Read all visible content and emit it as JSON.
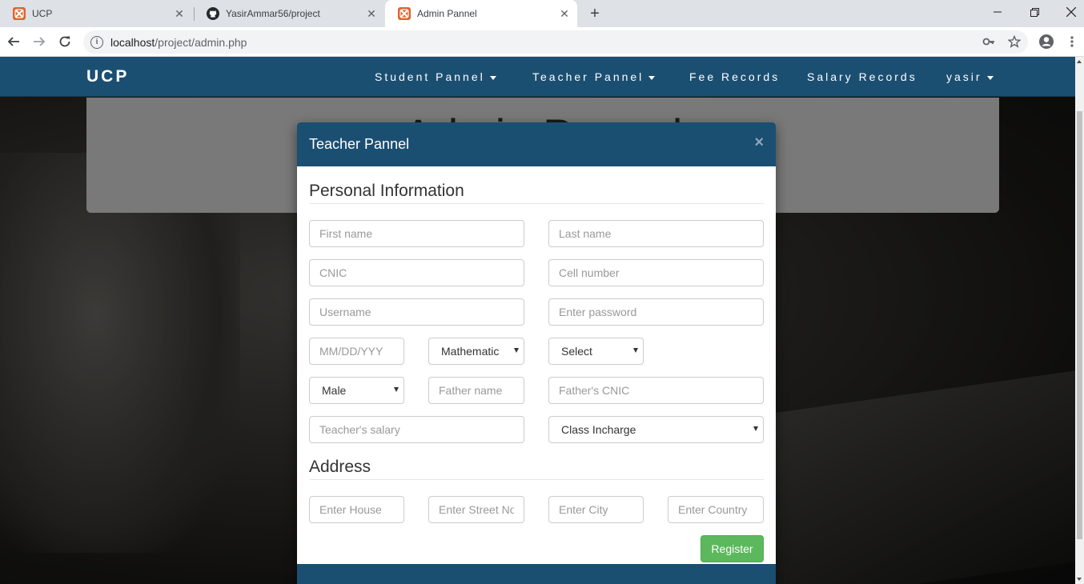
{
  "browser": {
    "tabs": [
      {
        "title": "UCP",
        "icon": "xampp-icon"
      },
      {
        "title": "YasirAmmar56/project",
        "icon": "github-icon"
      },
      {
        "title": "Admin Pannel",
        "icon": "xampp-icon",
        "active": true
      }
    ],
    "url_host": "localhost",
    "url_path": "/project/admin.php",
    "colors": {
      "tabstrip": "#dee1e6",
      "favicon": "#e2622c"
    }
  },
  "navbar": {
    "brand": "UCP",
    "links": [
      {
        "label": "Student Pannel",
        "dropdown": true
      },
      {
        "label": "Teacher Pannel",
        "dropdown": true
      },
      {
        "label": "Fee Records",
        "dropdown": false
      },
      {
        "label": "Salary Records",
        "dropdown": false
      },
      {
        "label": "yasir",
        "dropdown": true
      }
    ],
    "color": "#1b4f72"
  },
  "jumbotron": {
    "heading": "Admin Pannel"
  },
  "modal": {
    "title": "Teacher Pannel",
    "close": "×",
    "personal_heading": "Personal Information",
    "address_heading": "Address",
    "fields": {
      "first_name": "First name",
      "last_name": "Last name",
      "cnic": "CNIC",
      "cell": "Cell number",
      "username": "Username",
      "password": "Enter password",
      "dob": "MM/DD/YYY",
      "subject": "Mathematic",
      "select": "Select",
      "gender": "Male",
      "father_name": "Father name",
      "father_cnic": "Father's CNIC",
      "salary": "Teacher's salary",
      "class_incharge": "Class Incharge",
      "house": "Enter House",
      "street": "Enter Street No",
      "city": "Enter City",
      "country": "Enter Country"
    },
    "register": "Register",
    "register_color": "#5cb85c"
  }
}
